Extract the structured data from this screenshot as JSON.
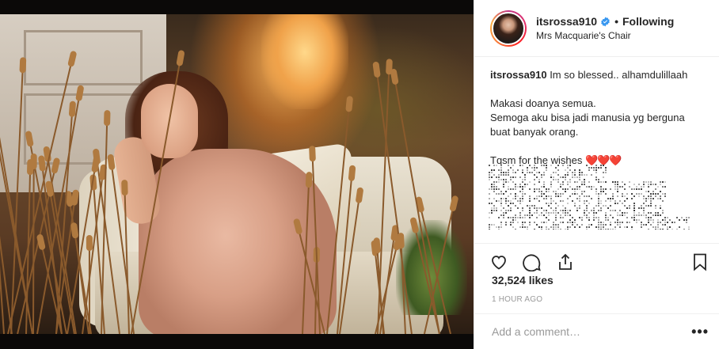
{
  "post": {
    "username": "itsrossa910",
    "follow_separator": "•",
    "follow_status": "Following",
    "location": "Mrs Macquarie's Chair",
    "caption_user": "itsrossa910",
    "caption_first": "Im so blessed.. alhamdulillaah",
    "caption_line2": "Makasi doanya semua.",
    "caption_line3": "Semoga aku bisa jadi manusia yg berguna buat banyak orang.",
    "caption_line4": "Tqsm for the wishes",
    "caption_emoji": "❤️❤️❤️",
    "likes": "32,524 likes",
    "time": "1 HOUR AGO",
    "comment_placeholder": "Add a comment…",
    "more_label": "•••"
  },
  "icons": {
    "verified": "verified-badge-icon",
    "like": "heart-icon",
    "comment": "comment-icon",
    "share": "share-icon",
    "save": "bookmark-icon",
    "more": "more-options-icon"
  },
  "colors": {
    "verified": "#3897f0",
    "text": "#262626",
    "muted": "#999999",
    "heart_emoji": "#e0245e"
  }
}
